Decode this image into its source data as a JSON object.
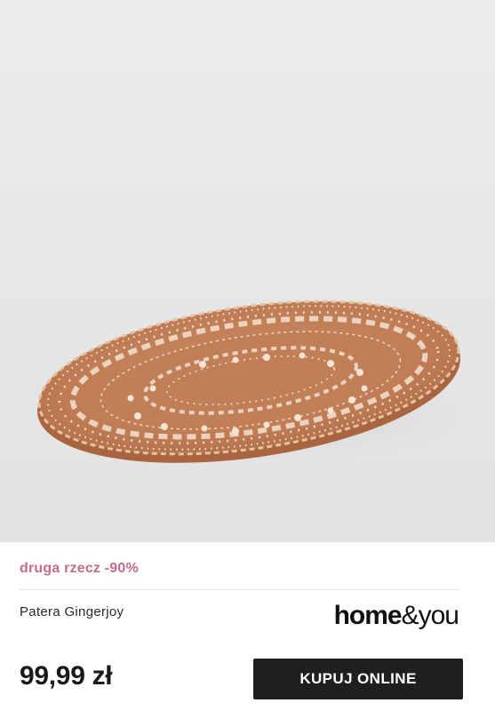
{
  "product": {
    "promo": "druga rzecz -90%",
    "name": "Patera Gingerjoy",
    "price": "99,99 zł",
    "buy_label": "KUPUJ ONLINE",
    "brand_home": "home",
    "brand_amp": "&",
    "brand_you": "you"
  },
  "colors": {
    "promo": "#c26b8e",
    "button_bg": "#1f1f1f",
    "plate": "#c9865c",
    "background": "#e8e8e8"
  }
}
